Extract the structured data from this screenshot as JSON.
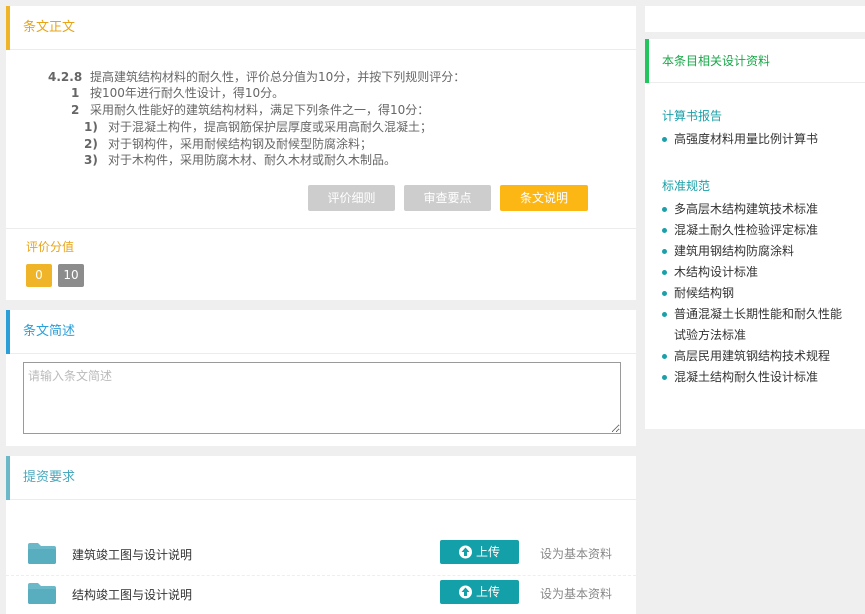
{
  "clause_panel": {
    "title": "条文正文",
    "clause_number": "4.2.8",
    "clause_text": "提高建筑结构材料的耐久性，评价总分值为10分，并按下列规则评分：",
    "rules": [
      {
        "num": "1",
        "text": "按100年进行耐久性设计，得10分。"
      },
      {
        "num": "2",
        "text": "采用耐久性能好的建筑结构材料，满足下列条件之一，得10分："
      }
    ],
    "subrules": [
      {
        "num": "1)",
        "text": "对于混凝土构件，提高钢筋保护层厚度或采用高耐久混凝土；"
      },
      {
        "num": "2)",
        "text": "对于钢构件，采用耐候结构钢及耐候型防腐涂料；"
      },
      {
        "num": "3)",
        "text": "对于木构件，采用防腐木材、耐久木材或耐久木制品。"
      }
    ],
    "buttons": {
      "detail": "评价细则",
      "review": "审查要点",
      "explain": "条文说明"
    },
    "score_title": "评价分值",
    "scores": [
      "0",
      "10"
    ],
    "colors": {
      "accent": "#f0b429",
      "score_selected": "#f0b429",
      "score_other": "#8c8c8c"
    }
  },
  "summary_panel": {
    "title": "条文简述",
    "placeholder": "请输入条文简述"
  },
  "submit_panel": {
    "title": "提资要求",
    "files": [
      {
        "name": "建筑竣工图与设计说明",
        "upload": "上传",
        "set_basic": "设为基本资料"
      },
      {
        "name": "结构竣工图与设计说明",
        "upload": "上传",
        "set_basic": "设为基本资料"
      }
    ]
  },
  "sidebar": {
    "title": "本条目相关设计资料",
    "sections": [
      {
        "title": "计算书报告",
        "items": [
          "高强度材料用量比例计算书"
        ]
      },
      {
        "title": "标准规范",
        "items": [
          "多高层木结构建筑技术标准",
          "混凝土耐久性检验评定标准",
          "建筑用钢结构防腐涂料",
          "木结构设计标准",
          "耐候结构钢",
          "普通混凝土长期性能和耐久性能试验方法标准",
          "高层民用建筑钢结构技术规程",
          "混凝土结构耐久性设计标准"
        ]
      }
    ]
  }
}
